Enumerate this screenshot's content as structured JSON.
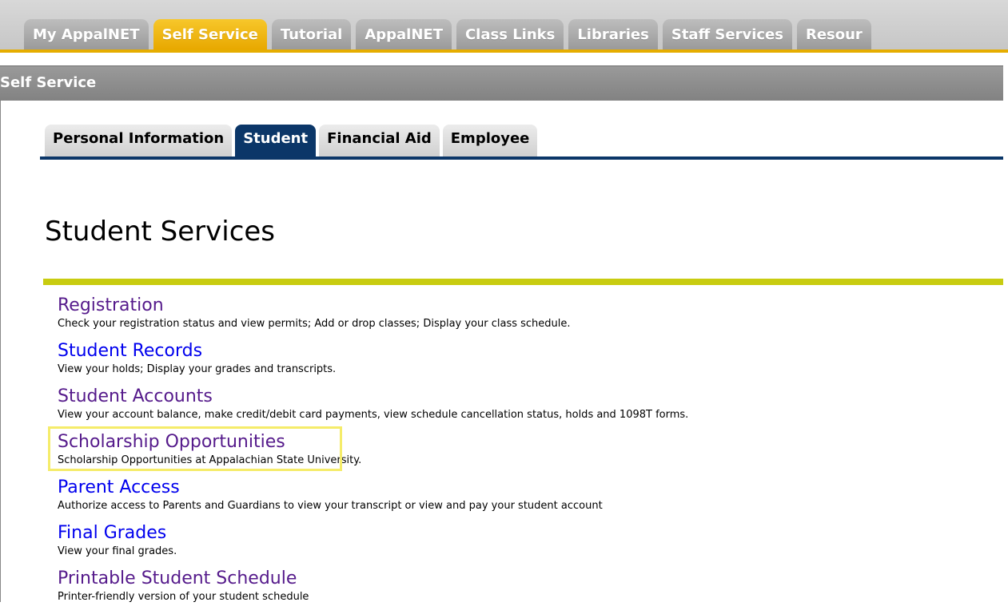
{
  "top_tabs": [
    {
      "label": "My AppalNET",
      "active": false
    },
    {
      "label": "Self Service",
      "active": true
    },
    {
      "label": "Tutorial",
      "active": false
    },
    {
      "label": "AppalNET",
      "active": false
    },
    {
      "label": "Class Links",
      "active": false
    },
    {
      "label": "Libraries",
      "active": false
    },
    {
      "label": "Staff Services",
      "active": false
    },
    {
      "label": "Resour",
      "active": false
    }
  ],
  "section_header": {
    "title": "Self Service"
  },
  "sub_tabs": [
    {
      "label": "Personal Information",
      "active": false
    },
    {
      "label": "Student",
      "active": true
    },
    {
      "label": "Financial Aid",
      "active": false
    },
    {
      "label": "Employee",
      "active": false
    }
  ],
  "page": {
    "title": "Student Services"
  },
  "menu_items": [
    {
      "title": "Registration",
      "description": "Check your registration status and view permits; Add or drop classes; Display your class schedule.",
      "visited": true
    },
    {
      "title": "Student Records",
      "description": "View your holds; Display your grades and transcripts.",
      "visited": false
    },
    {
      "title": "Student Accounts",
      "description": "View your account balance, make credit/debit card payments, view schedule cancellation status, holds and 1098T forms.",
      "visited": true
    },
    {
      "title": "Scholarship Opportunities",
      "description": "Scholarship Opportunities at Appalachian State University.",
      "visited": true,
      "highlighted": true
    },
    {
      "title": "Parent Access",
      "description": "Authorize access to Parents and Guardians to view your transcript or view and pay your student account",
      "visited": false
    },
    {
      "title": "Final Grades",
      "description": "View your final grades.",
      "visited": false
    },
    {
      "title": "Printable Student Schedule",
      "description": "Printer-friendly version of your student schedule",
      "visited": true
    }
  ],
  "colors": {
    "link": "#0000ee",
    "visited_link": "#551a8b",
    "active_top_tab": "#f0b400",
    "active_sub_tab": "#0b3668",
    "title_rule": "#c8cc10",
    "highlight": "#f5ec6a"
  }
}
